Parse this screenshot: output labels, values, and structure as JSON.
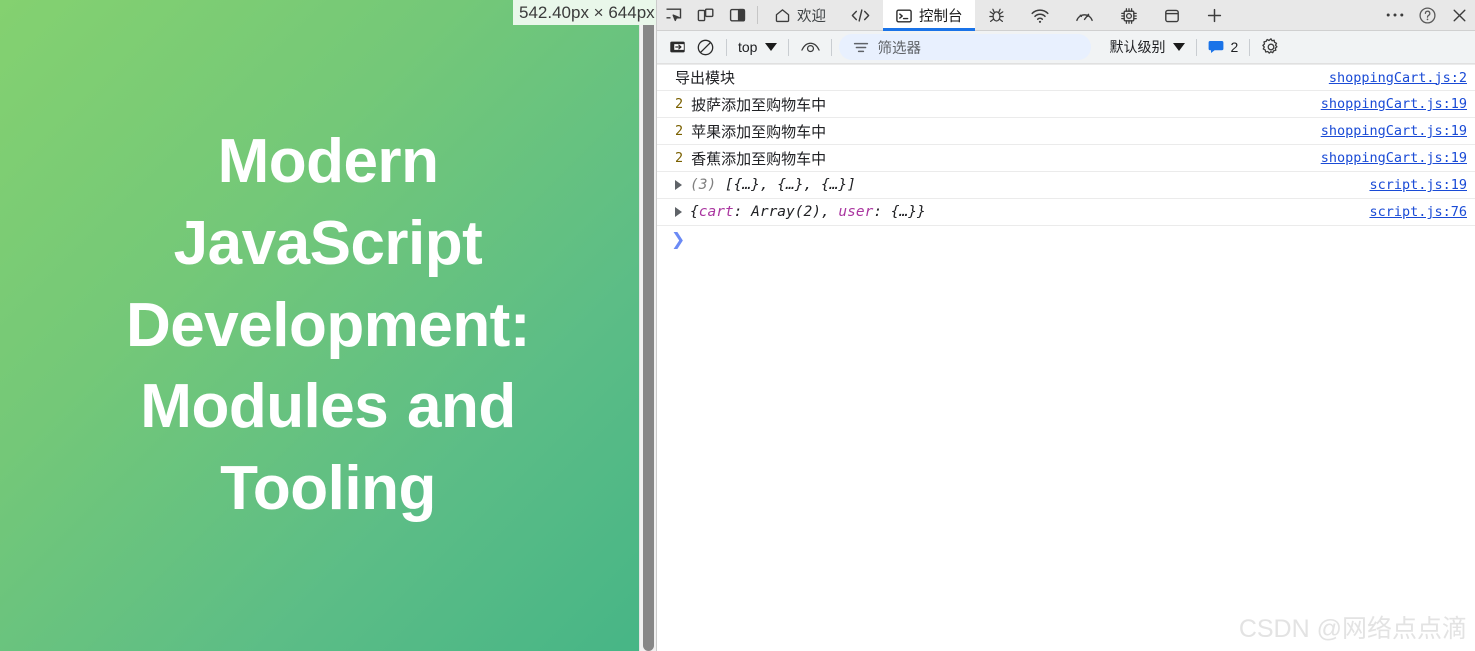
{
  "page_preview": {
    "hero_title": "Modern JavaScript Development: Modules and Tooling",
    "size_badge": "542.40px × 644px",
    "gradient_from": "#84d170",
    "gradient_to": "#46b586"
  },
  "devtools": {
    "tabstrip": {
      "left_icons": [
        {
          "name": "inspect-element-icon",
          "glyph": "inspect"
        },
        {
          "name": "device-toolbar-icon",
          "glyph": "device"
        },
        {
          "name": "dock-side-icon",
          "glyph": "dock"
        }
      ],
      "tabs": [
        {
          "label": "欢迎",
          "icon": "home-icon",
          "active": false
        },
        {
          "label": "",
          "icon": "elements-icon",
          "active": false
        },
        {
          "label": "控制台",
          "icon": "console-icon",
          "active": true
        },
        {
          "label": "",
          "icon": "debugger-bug-icon",
          "active": false
        },
        {
          "label": "",
          "icon": "network-icon",
          "active": false
        },
        {
          "label": "",
          "icon": "performance-icon",
          "active": false
        },
        {
          "label": "",
          "icon": "memory-chip-icon",
          "active": false
        },
        {
          "label": "",
          "icon": "application-storage-icon",
          "active": false
        },
        {
          "label": "",
          "icon": "add-tab-plus-icon",
          "active": false
        }
      ],
      "right_icons": [
        {
          "name": "more-options-icon",
          "glyph": "dots"
        },
        {
          "name": "help-icon",
          "glyph": "question"
        },
        {
          "name": "close-devtools-icon",
          "glyph": "close"
        }
      ],
      "active_tab_underline_color": "#1a73e8"
    },
    "console_toolbar": {
      "clear_console_label": "clear-console",
      "no_issues_label": "block-icon",
      "context_selector": "top",
      "live_expression_label": "eye-icon",
      "filter_placeholder": "筛选器",
      "level_selector": "默认级别",
      "message_count": "2",
      "settings_label": "settings"
    },
    "console_rows": [
      {
        "count": "",
        "text": "导出模块",
        "source": "shoppingCart.js:2",
        "type": "text"
      },
      {
        "count": "2",
        "text": "披萨添加至购物车中",
        "source": "shoppingCart.js:19",
        "type": "text"
      },
      {
        "count": "2",
        "text": "苹果添加至购物车中",
        "source": "shoppingCart.js:19",
        "type": "text"
      },
      {
        "count": "2",
        "text": "香蕉添加至购物车中",
        "source": "shoppingCart.js:19",
        "type": "text"
      },
      {
        "count": "",
        "text": "(3) [{…}, {…}, {…}]",
        "source": "script.js:19",
        "type": "object",
        "parts": [
          {
            "t": "(3) ",
            "c": "dim"
          },
          {
            "t": "[{…}, {…}, {…}]",
            "c": "brace"
          }
        ]
      },
      {
        "count": "",
        "text": "{cart: Array(2), user: {…}}",
        "source": "script.js:76",
        "type": "object",
        "parts": [
          {
            "t": "{",
            "c": "brace"
          },
          {
            "t": "cart",
            "c": "key"
          },
          {
            "t": ": Array(2), ",
            "c": "val"
          },
          {
            "t": "user",
            "c": "key"
          },
          {
            "t": ": {…}}",
            "c": "val"
          }
        ]
      }
    ],
    "prompt": {
      "chevron": "❯"
    }
  },
  "watermark": "CSDN @网络点点滴"
}
